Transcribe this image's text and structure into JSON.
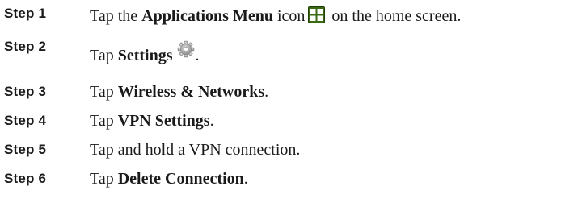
{
  "steps": [
    {
      "label": "Step 1",
      "text_before": "Tap the ",
      "bold": "Applications Menu",
      "text_mid": " icon",
      "icon": "applications-menu-icon",
      "text_after": " on the home screen."
    },
    {
      "label": "Step 2",
      "text_before": "Tap ",
      "bold": "Settings",
      "icon": "settings-gear-icon",
      "text_after": "."
    },
    {
      "label": "Step 3",
      "text_before": "Tap ",
      "bold": "Wireless & Networks",
      "text_after": "."
    },
    {
      "label": "Step 4",
      "text_before": "Tap ",
      "bold": "VPN Settings",
      "text_after": "."
    },
    {
      "label": "Step 5",
      "text": "Tap and hold a VPN connection."
    },
    {
      "label": "Step 6",
      "text_before": "Tap ",
      "bold": "Delete Connection",
      "text_after": "."
    }
  ],
  "colors": {
    "text": "#1a1a1a",
    "apps_icon_bg": "#3a6a12",
    "apps_icon_tile": "#ffffff",
    "settings_icon": "#9a9a9a"
  }
}
